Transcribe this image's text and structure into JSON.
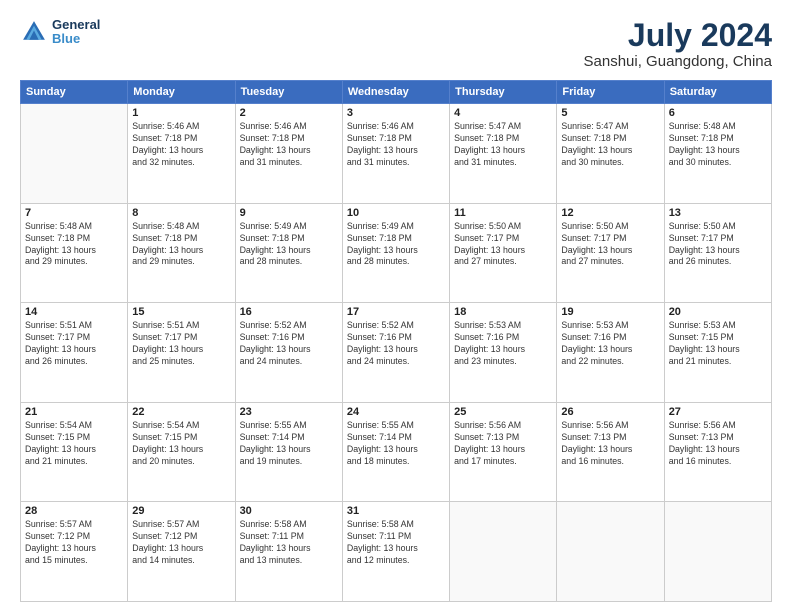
{
  "header": {
    "logo_line1": "General",
    "logo_line2": "Blue",
    "month_year": "July 2024",
    "location": "Sanshui, Guangdong, China"
  },
  "days_of_week": [
    "Sunday",
    "Monday",
    "Tuesday",
    "Wednesday",
    "Thursday",
    "Friday",
    "Saturday"
  ],
  "weeks": [
    [
      {
        "day": "",
        "info": ""
      },
      {
        "day": "1",
        "info": "Sunrise: 5:46 AM\nSunset: 7:18 PM\nDaylight: 13 hours\nand 32 minutes."
      },
      {
        "day": "2",
        "info": "Sunrise: 5:46 AM\nSunset: 7:18 PM\nDaylight: 13 hours\nand 31 minutes."
      },
      {
        "day": "3",
        "info": "Sunrise: 5:46 AM\nSunset: 7:18 PM\nDaylight: 13 hours\nand 31 minutes."
      },
      {
        "day": "4",
        "info": "Sunrise: 5:47 AM\nSunset: 7:18 PM\nDaylight: 13 hours\nand 31 minutes."
      },
      {
        "day": "5",
        "info": "Sunrise: 5:47 AM\nSunset: 7:18 PM\nDaylight: 13 hours\nand 30 minutes."
      },
      {
        "day": "6",
        "info": "Sunrise: 5:48 AM\nSunset: 7:18 PM\nDaylight: 13 hours\nand 30 minutes."
      }
    ],
    [
      {
        "day": "7",
        "info": "Sunrise: 5:48 AM\nSunset: 7:18 PM\nDaylight: 13 hours\nand 29 minutes."
      },
      {
        "day": "8",
        "info": "Sunrise: 5:48 AM\nSunset: 7:18 PM\nDaylight: 13 hours\nand 29 minutes."
      },
      {
        "day": "9",
        "info": "Sunrise: 5:49 AM\nSunset: 7:18 PM\nDaylight: 13 hours\nand 28 minutes."
      },
      {
        "day": "10",
        "info": "Sunrise: 5:49 AM\nSunset: 7:18 PM\nDaylight: 13 hours\nand 28 minutes."
      },
      {
        "day": "11",
        "info": "Sunrise: 5:50 AM\nSunset: 7:17 PM\nDaylight: 13 hours\nand 27 minutes."
      },
      {
        "day": "12",
        "info": "Sunrise: 5:50 AM\nSunset: 7:17 PM\nDaylight: 13 hours\nand 27 minutes."
      },
      {
        "day": "13",
        "info": "Sunrise: 5:50 AM\nSunset: 7:17 PM\nDaylight: 13 hours\nand 26 minutes."
      }
    ],
    [
      {
        "day": "14",
        "info": "Sunrise: 5:51 AM\nSunset: 7:17 PM\nDaylight: 13 hours\nand 26 minutes."
      },
      {
        "day": "15",
        "info": "Sunrise: 5:51 AM\nSunset: 7:17 PM\nDaylight: 13 hours\nand 25 minutes."
      },
      {
        "day": "16",
        "info": "Sunrise: 5:52 AM\nSunset: 7:16 PM\nDaylight: 13 hours\nand 24 minutes."
      },
      {
        "day": "17",
        "info": "Sunrise: 5:52 AM\nSunset: 7:16 PM\nDaylight: 13 hours\nand 24 minutes."
      },
      {
        "day": "18",
        "info": "Sunrise: 5:53 AM\nSunset: 7:16 PM\nDaylight: 13 hours\nand 23 minutes."
      },
      {
        "day": "19",
        "info": "Sunrise: 5:53 AM\nSunset: 7:16 PM\nDaylight: 13 hours\nand 22 minutes."
      },
      {
        "day": "20",
        "info": "Sunrise: 5:53 AM\nSunset: 7:15 PM\nDaylight: 13 hours\nand 21 minutes."
      }
    ],
    [
      {
        "day": "21",
        "info": "Sunrise: 5:54 AM\nSunset: 7:15 PM\nDaylight: 13 hours\nand 21 minutes."
      },
      {
        "day": "22",
        "info": "Sunrise: 5:54 AM\nSunset: 7:15 PM\nDaylight: 13 hours\nand 20 minutes."
      },
      {
        "day": "23",
        "info": "Sunrise: 5:55 AM\nSunset: 7:14 PM\nDaylight: 13 hours\nand 19 minutes."
      },
      {
        "day": "24",
        "info": "Sunrise: 5:55 AM\nSunset: 7:14 PM\nDaylight: 13 hours\nand 18 minutes."
      },
      {
        "day": "25",
        "info": "Sunrise: 5:56 AM\nSunset: 7:13 PM\nDaylight: 13 hours\nand 17 minutes."
      },
      {
        "day": "26",
        "info": "Sunrise: 5:56 AM\nSunset: 7:13 PM\nDaylight: 13 hours\nand 16 minutes."
      },
      {
        "day": "27",
        "info": "Sunrise: 5:56 AM\nSunset: 7:13 PM\nDaylight: 13 hours\nand 16 minutes."
      }
    ],
    [
      {
        "day": "28",
        "info": "Sunrise: 5:57 AM\nSunset: 7:12 PM\nDaylight: 13 hours\nand 15 minutes."
      },
      {
        "day": "29",
        "info": "Sunrise: 5:57 AM\nSunset: 7:12 PM\nDaylight: 13 hours\nand 14 minutes."
      },
      {
        "day": "30",
        "info": "Sunrise: 5:58 AM\nSunset: 7:11 PM\nDaylight: 13 hours\nand 13 minutes."
      },
      {
        "day": "31",
        "info": "Sunrise: 5:58 AM\nSunset: 7:11 PM\nDaylight: 13 hours\nand 12 minutes."
      },
      {
        "day": "",
        "info": ""
      },
      {
        "day": "",
        "info": ""
      },
      {
        "day": "",
        "info": ""
      }
    ]
  ]
}
